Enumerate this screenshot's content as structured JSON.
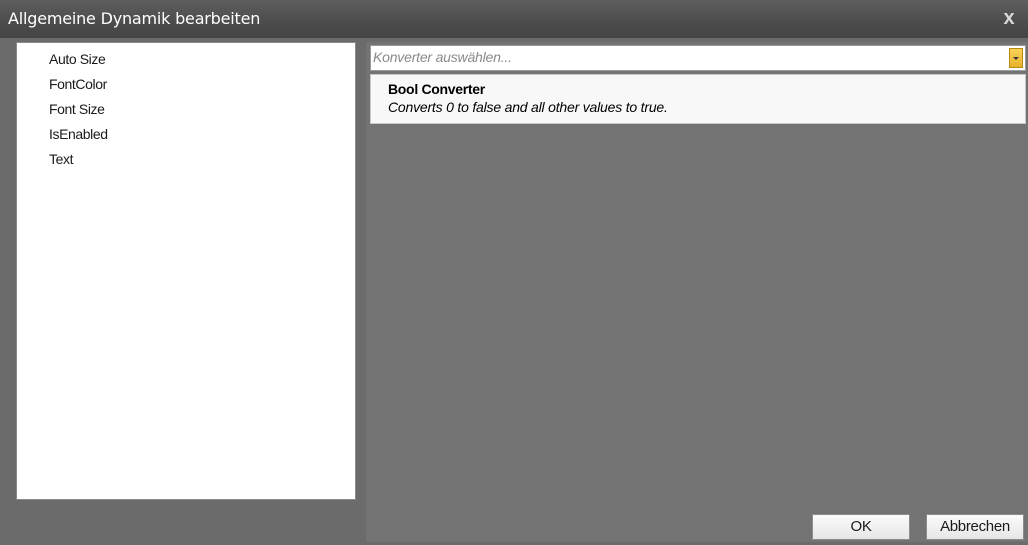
{
  "window": {
    "title": "Allgemeine Dynamik bearbeiten",
    "close_label": "x"
  },
  "properties": [
    {
      "label": "Auto Size"
    },
    {
      "label": "FontColor"
    },
    {
      "label": "Font Size"
    },
    {
      "label": "IsEnabled"
    },
    {
      "label": "Text"
    }
  ],
  "converter": {
    "placeholder": "Konverter auswählen...",
    "options": [
      {
        "title": "Bool Converter",
        "description": "Converts 0 to false and all other values to true."
      }
    ]
  },
  "buttons": {
    "ok": "OK",
    "cancel": "Abbrechen"
  },
  "colors": {
    "titlebar": "#4d4d4d",
    "background": "#6b6b6b",
    "dropdown_accent": "#e9b12a"
  },
  "icons": {
    "close": "close-icon",
    "dropdown": "chevron-down-icon"
  }
}
